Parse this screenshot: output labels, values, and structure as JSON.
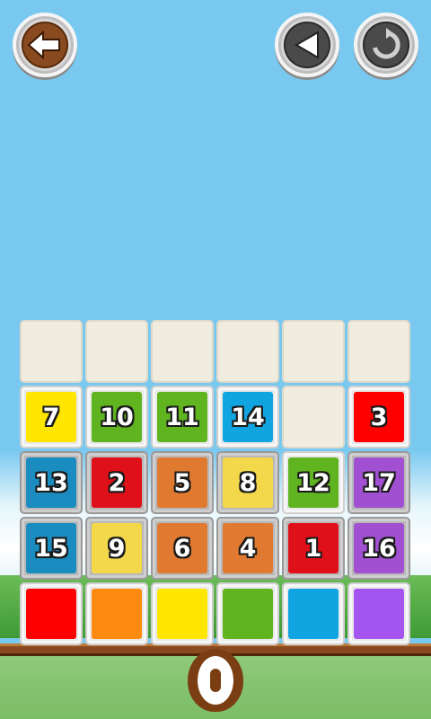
{
  "toolbar": {
    "back_icon": "arrow-left-icon",
    "undo_icon": "triangle-left-icon",
    "restart_icon": "refresh-icon"
  },
  "board": {
    "empty_top_row": 6,
    "rows": [
      [
        {
          "label": "7",
          "color": "#ffe600"
        },
        {
          "label": "10",
          "color": "#5fb41f"
        },
        {
          "label": "11",
          "color": "#5fb41f"
        },
        {
          "label": "14",
          "color": "#10a4e0"
        },
        null,
        {
          "label": "3",
          "color": "#ff0000"
        }
      ],
      [
        {
          "label": "13",
          "color": "#1a8cc0"
        },
        {
          "label": "2",
          "color": "#e0101a"
        },
        {
          "label": "5",
          "color": "#e07a30"
        },
        {
          "label": "8",
          "color": "#f2d84a"
        },
        {
          "label": "12",
          "color": "#5fb41f"
        },
        {
          "label": "17",
          "color": "#a050d0"
        }
      ],
      [
        {
          "label": "15",
          "color": "#1a8cc0"
        },
        {
          "label": "9",
          "color": "#f2d84a"
        },
        {
          "label": "6",
          "color": "#e07a30"
        },
        {
          "label": "4",
          "color": "#e07a30"
        },
        {
          "label": "1",
          "color": "#e0101a"
        },
        {
          "label": "16",
          "color": "#a050d0"
        }
      ]
    ],
    "targets": [
      "#ff0000",
      "#ff8a10",
      "#ffe600",
      "#5fb41f",
      "#10a4e0",
      "#a455f0"
    ]
  }
}
